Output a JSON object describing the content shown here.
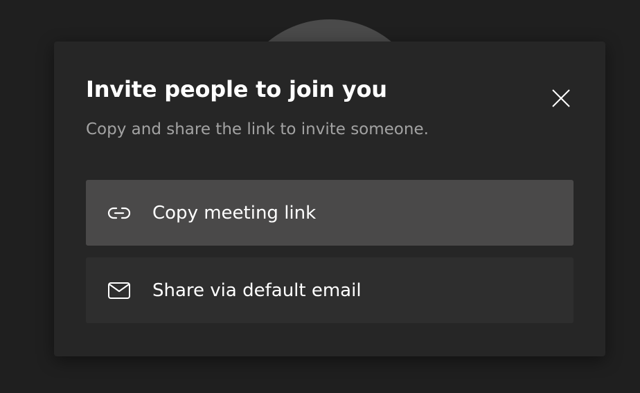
{
  "dialog": {
    "title": "Invite people to join you",
    "subtitle": "Copy and share the link to invite someone.",
    "close_icon": "close-icon",
    "options": [
      {
        "label": "Copy meeting link",
        "icon": "link-icon"
      },
      {
        "label": "Share via default email",
        "icon": "mail-icon"
      }
    ]
  },
  "colors": {
    "background": "#1f1f1f",
    "dialog": "#262626",
    "option_highlight": "#4a4949",
    "option": "#2e2e2e",
    "text_primary": "#ffffff",
    "text_secondary": "#a3a3a3"
  }
}
